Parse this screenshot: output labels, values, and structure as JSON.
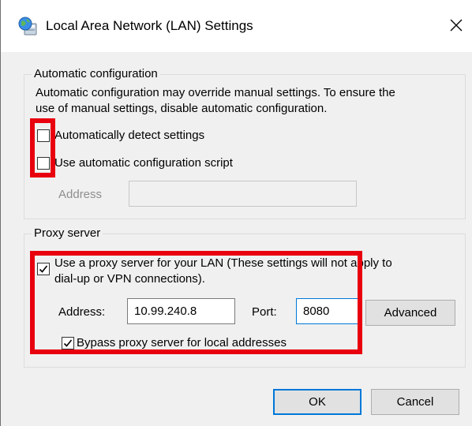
{
  "window": {
    "title": "Local Area Network (LAN) Settings",
    "icon": "network-globe-icon",
    "close_icon": "close-icon"
  },
  "auto_config": {
    "group_label": "Automatic configuration",
    "description_line1": "Automatic configuration may override manual settings.  To ensure the",
    "description_line2": "use of manual settings, disable automatic configuration.",
    "detect_checkbox": {
      "label": "Automatically detect settings",
      "checked": false
    },
    "script_checkbox": {
      "label": "Use automatic configuration script",
      "checked": false
    },
    "address_label": "Address",
    "address_value": ""
  },
  "proxy": {
    "group_label": "Proxy server",
    "use_proxy_checkbox": {
      "label_line1": "Use a proxy server for your LAN (These settings will not apply to",
      "label_line2": "dial-up or VPN connections).",
      "checked": true
    },
    "address_label": "Address:",
    "address_value": "10.99.240.8",
    "port_label": "Port:",
    "port_value": "8080",
    "advanced_button": "Advanced",
    "bypass_checkbox": {
      "label": "Bypass proxy server for local addresses",
      "checked": true
    }
  },
  "buttons": {
    "ok": "OK",
    "cancel": "Cancel"
  },
  "colors": {
    "highlight": "#e8000f",
    "focus_accent": "#0078d7",
    "dialog_background": "#f0f0f0"
  }
}
